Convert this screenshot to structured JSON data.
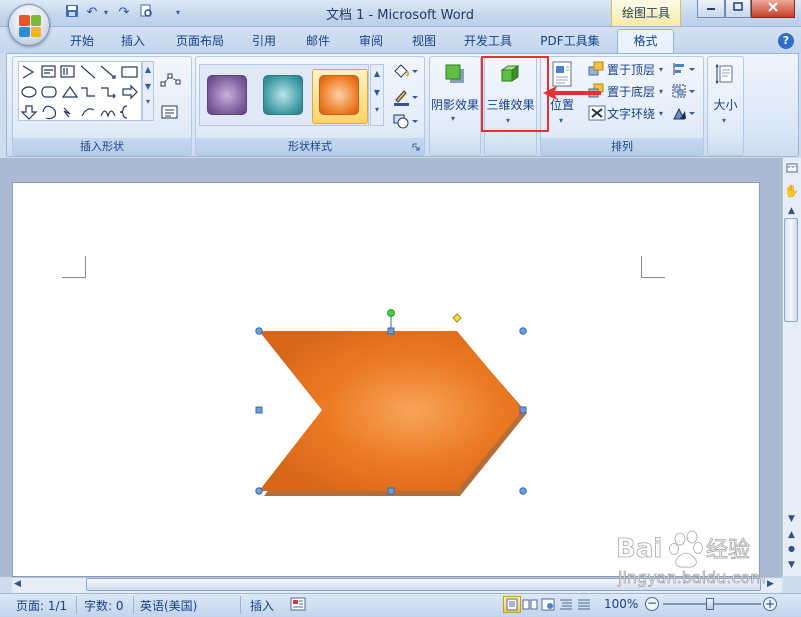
{
  "window": {
    "title": "文档 1 - Microsoft Word",
    "context_tab_title": "绘图工具"
  },
  "tabs": [
    "开始",
    "插入",
    "页面布局",
    "引用",
    "邮件",
    "审阅",
    "视图",
    "开发工具",
    "PDF工具集",
    "格式"
  ],
  "active_tab": "格式",
  "ribbon": {
    "insert_shapes": {
      "label": "插入形状"
    },
    "shape_styles": {
      "label": "形状样式",
      "swatches": [
        "#7d5b9c",
        "#3f9ba4",
        "#ec7a22"
      ]
    },
    "shadow_effects": {
      "label": "阴影效果"
    },
    "effects_3d": {
      "label": "三维效果"
    },
    "arrange": {
      "label": "排列",
      "position": "位置",
      "bring_to_front": "置于顶层",
      "send_to_back": "置于底层",
      "text_wrapping": "文字环绕"
    },
    "size": {
      "label": "大小"
    }
  },
  "document": {
    "shape": {
      "type": "chevron",
      "fill_color": "#e8762a"
    }
  },
  "statusbar": {
    "page": "页面: 1/1",
    "words": "字数: 0",
    "language": "英语(美国)",
    "mode": "插入",
    "zoom": "100%"
  },
  "watermark": {
    "brand": "Baidu 经验",
    "url": "jingyan.baidu.com"
  },
  "colors": {
    "highlight": "#e23232",
    "arrow": "#e23232",
    "ribbon_text": "#15428b"
  }
}
